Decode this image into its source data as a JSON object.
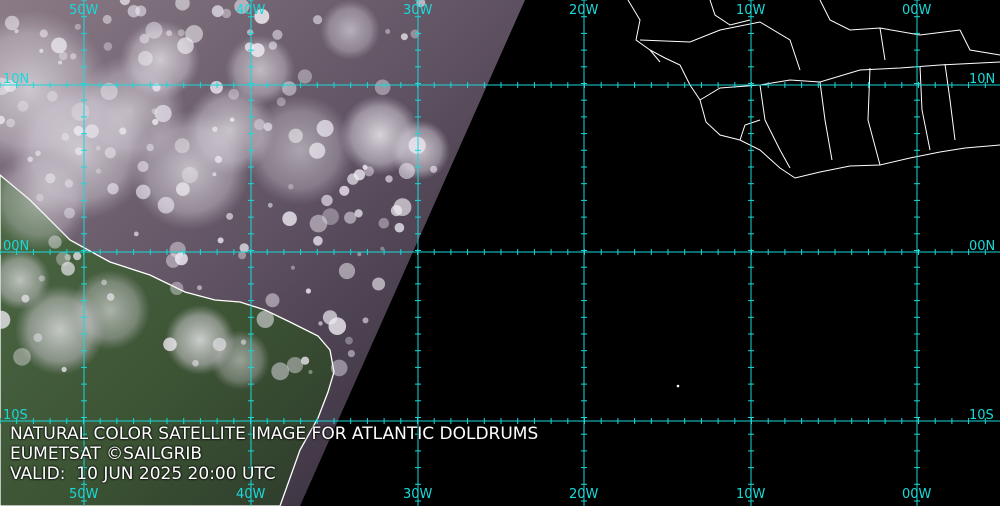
{
  "caption": {
    "title": "NATURAL COLOR SATELLITE IMAGE FOR ATLANTIC DOLDRUMS",
    "credit": "EUMETSAT ©SAILGRIB",
    "valid": "VALID:  10 JUN 2025 20:00 UTC"
  },
  "grid": {
    "longitude_labels": [
      "50W",
      "40W",
      "30W",
      "20W",
      "10W",
      "00W"
    ],
    "latitude_labels": [
      "10N",
      "00N",
      "10S"
    ]
  },
  "colors": {
    "grid": "#19d9d9",
    "caption_text": "#ffffff",
    "night_side": "#000000",
    "ocean_day": "#5a4f5c",
    "land_day": "#3f5a3a",
    "clouds": "#e6e2ea",
    "coastline": "#ffffff"
  }
}
